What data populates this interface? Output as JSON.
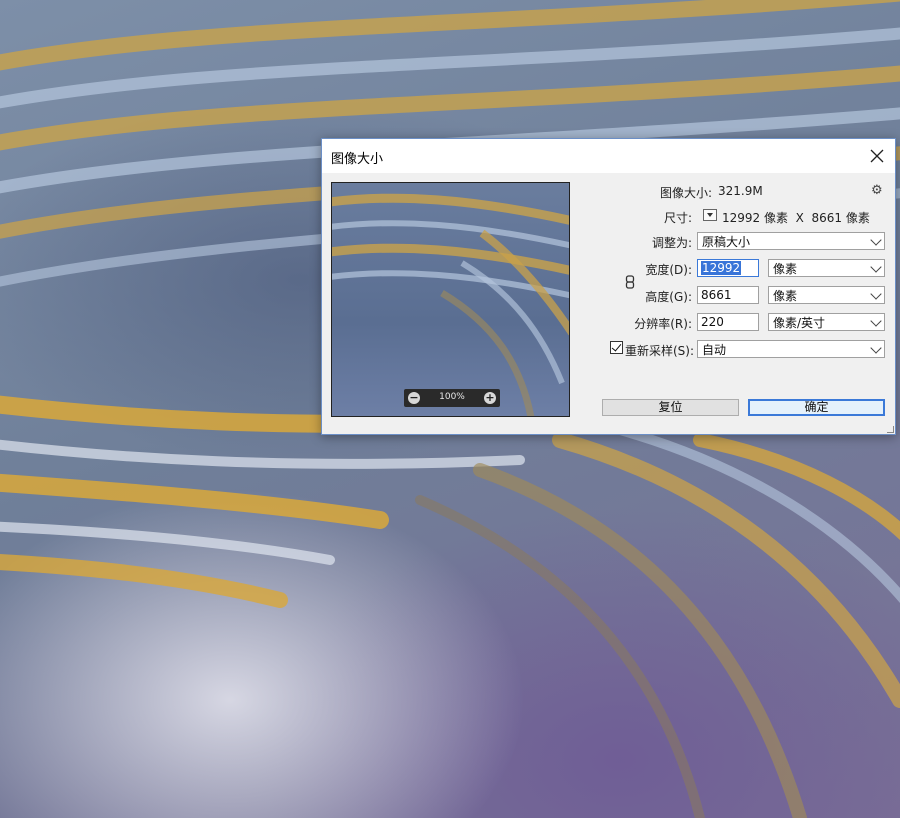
{
  "dialog": {
    "title": "图像大小",
    "close_icon": "close-icon",
    "preview": {
      "zoom": "100%",
      "zoom_out_icon": "minus-circle-icon",
      "zoom_in_icon": "plus-circle-icon"
    },
    "image_size_label": "图像大小:",
    "image_size_value": "321.9M",
    "settings_icon": "gear-icon",
    "dimensions_label": "尺寸:",
    "dimensions_value": "12992 像素  X  8661 像素",
    "fit_to_label": "调整为:",
    "fit_to_value": "原稿大小",
    "width_label": "宽度(D):",
    "width_value": "12992",
    "width_unit": "像素",
    "height_label": "高度(G):",
    "height_value": "8661",
    "height_unit": "像素",
    "resolution_label": "分辨率(R):",
    "resolution_value": "220",
    "resolution_unit": "像素/英寸",
    "resample_label": "重新采样(S):",
    "resample_checked": true,
    "resample_value": "自动",
    "reset_button": "复位",
    "ok_button": "确定",
    "accent_color": "#3b79d8"
  }
}
